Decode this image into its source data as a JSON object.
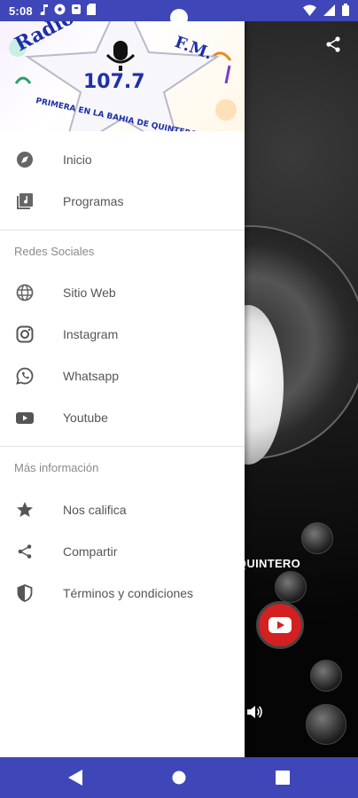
{
  "status_bar": {
    "time": "5:08",
    "left_icons": [
      "music-note-icon",
      "gear-app-icon",
      "vpn-icon",
      "sd-card-icon"
    ],
    "right_icons": [
      "wifi-icon",
      "signal-icon",
      "battery-icon"
    ]
  },
  "header": {
    "logo_text_top": "Radio",
    "logo_fm": "F.M.",
    "frequency": "107.7",
    "slogan": "PRIMERA EN LA BAHIA DE QUINTERO"
  },
  "menu": {
    "main_items": [
      {
        "label": "Inicio",
        "icon": "compass-icon"
      },
      {
        "label": "Programas",
        "icon": "playlist-icon"
      }
    ],
    "social_section_title": "Redes Sociales",
    "social_items": [
      {
        "label": "Sitio Web",
        "icon": "globe-icon"
      },
      {
        "label": "Instagram",
        "icon": "instagram-icon"
      },
      {
        "label": "Whatsapp",
        "icon": "whatsapp-icon"
      },
      {
        "label": "Youtube",
        "icon": "youtube-icon"
      }
    ],
    "info_section_title": "Más información",
    "info_items": [
      {
        "label": "Nos califica",
        "icon": "star-icon"
      },
      {
        "label": "Compartir",
        "icon": "share-icon"
      },
      {
        "label": "Términos y condiciones",
        "icon": "shield-icon"
      }
    ]
  },
  "player": {
    "station_name_partial": "QUINTERO"
  },
  "colors": {
    "system_bar": "#3f46b8",
    "logo_blue": "#1e2fa8",
    "youtube_red": "#d32020"
  }
}
